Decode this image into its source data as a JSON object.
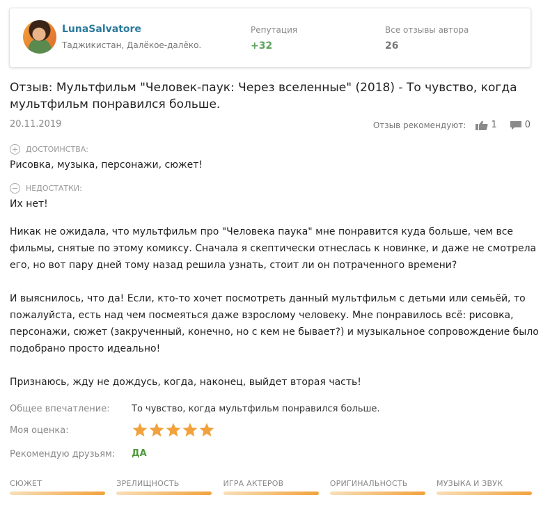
{
  "author": {
    "name": "LunaSalvatore",
    "location": "Таджикистан, Далёкое-далёко.",
    "reputation_label": "Репутация",
    "reputation_value": "+32",
    "all_reviews_label": "Все отзывы автора",
    "all_reviews_value": "26"
  },
  "review": {
    "title": "Отзыв: Мультфильм \"Человек-паук: Через вселенные\" (2018) - То чувство, когда мультфильм понравился больше.",
    "date": "20.11.2019",
    "recommend_label": "Отзыв рекомендуют:",
    "likes": "1",
    "comments": "0",
    "pros_label": "ДОСТОИНСТВА:",
    "pros_text": "Рисовка, музыка, персонажи, сюжет!",
    "cons_label": "НЕДОСТАТКИ:",
    "cons_text": "Их нет!",
    "paragraphs": [
      "Никак не ожидала, что мультфильм про \"Человека паука\" мне понравится куда больше, чем все фильмы, снятые по этому комиксу. Сначала я скептически отнеслась к новинке, и даже не смотрела его, но вот пару дней тому назад решила узнать, стоит ли он потраченного времени?",
      "И выяснилось, что да! Если, кто-то хочет посмотреть данный мультфильм с детьми или семьёй, то пожалуйста, есть над чем посмеяться даже взрослому человеку. Мне понравилось всё: рисовка, персонажи, сюжет (закрученный, конечно, но с кем не бывает?) и музыкальное сопровождение было подобрано просто идеально!",
      "Признаюсь, жду не дождусь, когда, наконец, выйдет вторая часть!"
    ],
    "impression_label": "Общее впечатление:",
    "impression_value": "То чувство, когда мультфильм понравился больше.",
    "rating_label": "Моя оценка:",
    "rating": 5,
    "rating_max": 5,
    "recommend_friends_label": "Рекомендую друзьям:",
    "recommend_friends_value": "ДА"
  },
  "categories": [
    {
      "label": "СЮЖЕТ",
      "fill": 1.0
    },
    {
      "label": "ЗРЕЛИЩНОСТЬ",
      "fill": 1.0
    },
    {
      "label": "ИГРА АКТЕРОВ",
      "fill": 1.0
    },
    {
      "label": "ОРИГИНАЛЬНОСТЬ",
      "fill": 1.0
    },
    {
      "label": "МУЗЫКА И ЗВУК",
      "fill": 1.0
    }
  ],
  "colors": {
    "author_link": "#2b7a9b",
    "reputation": "#5aa35a",
    "star": "#f2a23c",
    "yes": "#4f9a3c"
  }
}
